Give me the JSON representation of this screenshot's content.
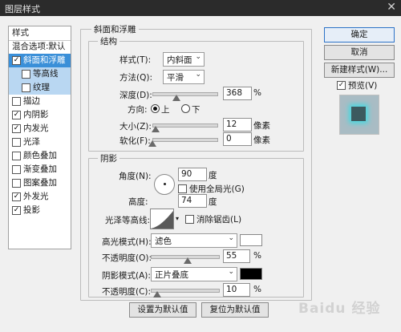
{
  "window": {
    "title": "图层样式",
    "close_glyph": "✕"
  },
  "styles_list": {
    "header": "样式",
    "items": [
      {
        "label": "混合选项:默认",
        "checkbox": false,
        "checked": false,
        "state": "normal"
      },
      {
        "label": "斜面和浮雕",
        "checkbox": true,
        "checked": true,
        "state": "selected"
      },
      {
        "label": "等高线",
        "checkbox": true,
        "checked": false,
        "state": "sub"
      },
      {
        "label": "纹理",
        "checkbox": true,
        "checked": false,
        "state": "sub"
      },
      {
        "label": "描边",
        "checkbox": true,
        "checked": false,
        "state": "normal"
      },
      {
        "label": "内阴影",
        "checkbox": true,
        "checked": true,
        "state": "normal"
      },
      {
        "label": "内发光",
        "checkbox": true,
        "checked": true,
        "state": "normal"
      },
      {
        "label": "光泽",
        "checkbox": true,
        "checked": false,
        "state": "normal"
      },
      {
        "label": "颜色叠加",
        "checkbox": true,
        "checked": false,
        "state": "normal"
      },
      {
        "label": "渐变叠加",
        "checkbox": true,
        "checked": false,
        "state": "normal"
      },
      {
        "label": "图案叠加",
        "checkbox": true,
        "checked": false,
        "state": "normal"
      },
      {
        "label": "外发光",
        "checkbox": true,
        "checked": true,
        "state": "normal"
      },
      {
        "label": "投影",
        "checkbox": true,
        "checked": true,
        "state": "normal"
      }
    ]
  },
  "bevel": {
    "group_title": "斜面和浮雕",
    "structure_title": "结构",
    "style_label": "样式(T):",
    "style_value": "内斜面",
    "technique_label": "方法(Q):",
    "technique_value": "平滑",
    "depth_label": "深度(D):",
    "depth_value": "368",
    "depth_unit": "%",
    "depth_fraction": 0.37,
    "direction_label": "方向:",
    "direction_up": "上",
    "direction_down": "下",
    "direction_selected": "上",
    "size_label": "大小(Z):",
    "size_value": "12",
    "size_unit": "像素",
    "size_fraction": 0.05,
    "soften_label": "软化(F):",
    "soften_value": "0",
    "soften_unit": "像素",
    "soften_fraction": 0.0
  },
  "shading": {
    "title": "阴影",
    "angle_label": "角度(N):",
    "angle_value": "90",
    "angle_unit": "度",
    "global_light_label": "使用全局光(G)",
    "global_light_checked": false,
    "altitude_label": "高度:",
    "altitude_value": "74",
    "altitude_unit": "度",
    "gloss_label": "光泽等高线:",
    "antialias_label": "消除锯齿(L)",
    "antialias_checked": false,
    "highlight_mode_label": "高光模式(H):",
    "highlight_mode_value": "滤色",
    "highlight_color": "#ffffff",
    "highlight_opacity_label": "不透明度(O):",
    "highlight_opacity_value": "55",
    "highlight_opacity_unit": "%",
    "highlight_opacity_fraction": 0.55,
    "shadow_mode_label": "阴影模式(A):",
    "shadow_mode_value": "正片叠底",
    "shadow_color": "#000000",
    "shadow_opacity_label": "不透明度(C):",
    "shadow_opacity_value": "10",
    "shadow_opacity_unit": "%",
    "shadow_opacity_fraction": 0.1
  },
  "footer": {
    "make_default": "设置为默认值",
    "reset_default": "复位为默认值"
  },
  "right": {
    "ok": "确定",
    "cancel": "取消",
    "new_style": "新建样式(W)...",
    "preview_label": "预览(V)",
    "preview_checked": true
  },
  "watermark": "Baidu 经验",
  "colors": {
    "accent": "#3a8fd8",
    "selection_sub": "#b9d7f2",
    "glow": "#49d8e0"
  }
}
